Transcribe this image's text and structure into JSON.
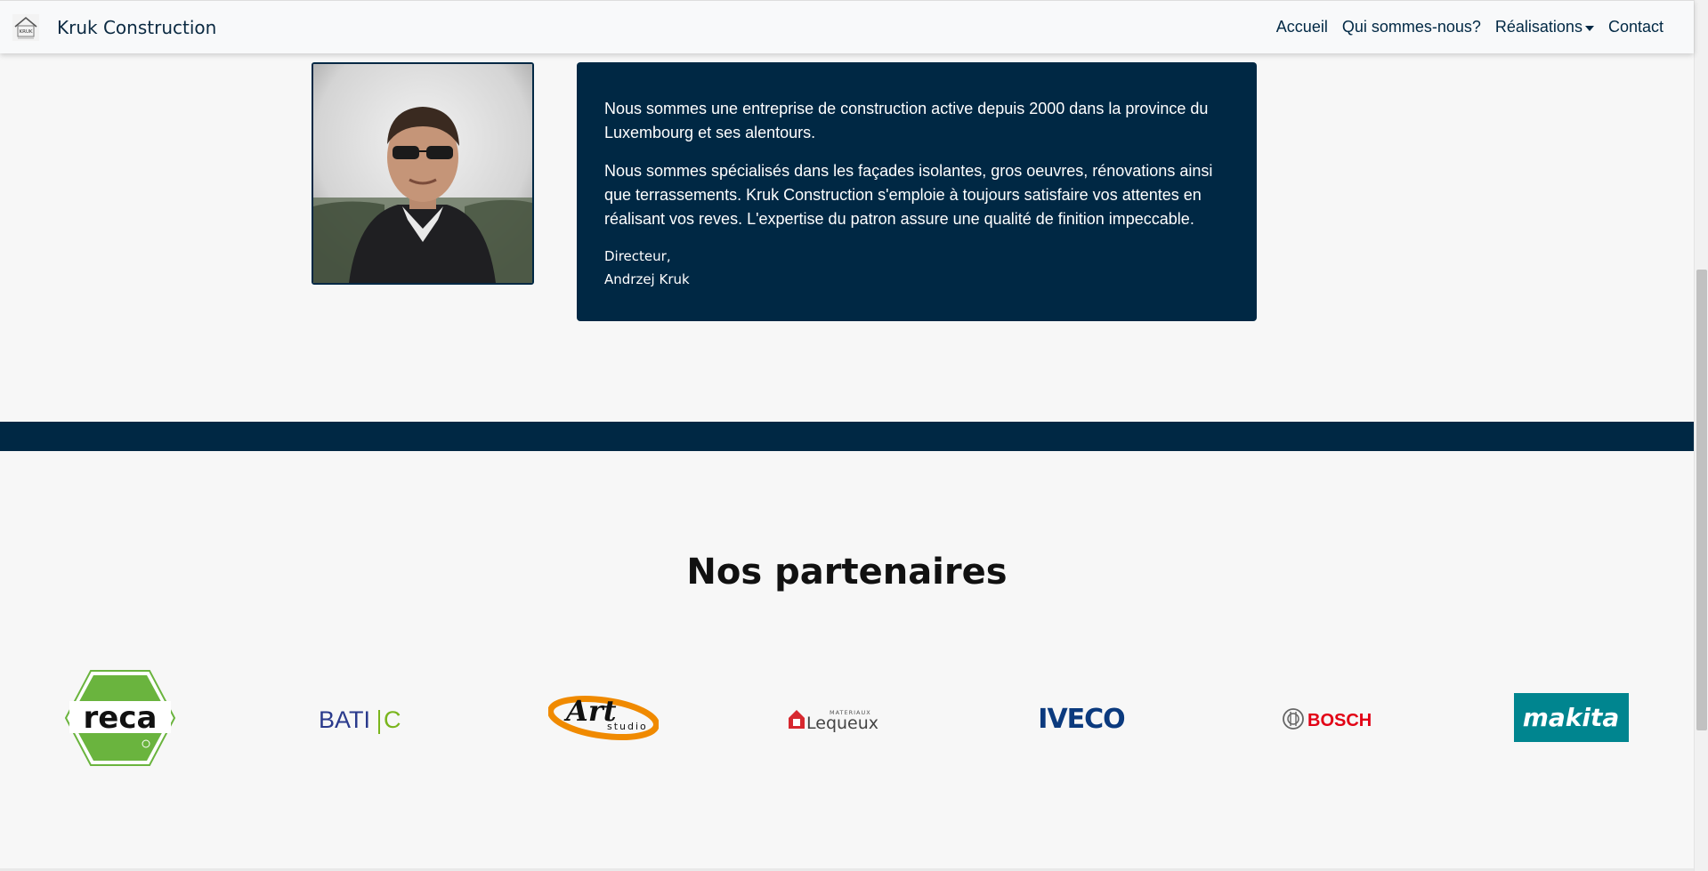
{
  "navbar": {
    "brand_name": "Kruk Construction",
    "logo_text": "KRUK",
    "links": [
      {
        "label": "Accueil"
      },
      {
        "label": "Qui sommes-nous?"
      },
      {
        "label": "Réalisations",
        "has_dropdown": true
      },
      {
        "label": "Contact"
      }
    ]
  },
  "about": {
    "paragraph_1": "Nous sommes une entreprise de construction active depuis 2000 dans la province du Luxembourg et ses alentours.",
    "paragraph_2": "Nous sommes spécialisés dans les façades isolantes, gros oeuvres, rénovations ainsi que terrassements. Kruk Construction s'emploie à toujours satisfaire vos attentes en réalisant vos reves. L'expertise du patron assure une qualité de finition impeccable.",
    "signature_role": "Directeur,",
    "signature_name": "Andrzej Kruk"
  },
  "partners": {
    "title": "Nos partenaires",
    "logos": [
      {
        "name": "reca",
        "text": "reca",
        "color": "#6ab43e"
      },
      {
        "name": "batic",
        "text_a": "BATI",
        "text_b": "C",
        "color": "#2a3a8c",
        "accent": "#7ab51d"
      },
      {
        "name": "art-studio",
        "text_a": "Art",
        "text_b": "studio",
        "color": "#f08a00"
      },
      {
        "name": "lequeux",
        "text_small": "MATERIAUX",
        "text": "Lequeux",
        "color": "#d7282f"
      },
      {
        "name": "iveco",
        "text": "IVECO",
        "color": "#0b3a7e"
      },
      {
        "name": "bosch",
        "text": "BOSCH",
        "color": "#e20015"
      },
      {
        "name": "makita",
        "text": "makita",
        "color": "#00858f"
      }
    ]
  },
  "colors": {
    "navy": "#002844",
    "background": "#f7f7f7"
  }
}
